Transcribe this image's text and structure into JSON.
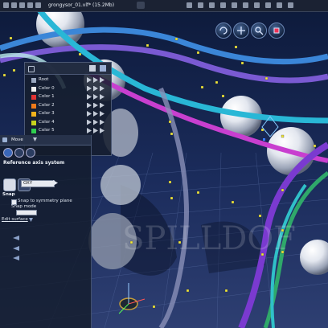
{
  "topbar": {
    "file_title": "grongysor_01.vlf* (15.2Mb)",
    "icons": [
      "file-icon",
      "open-icon",
      "save-icon",
      "undo-icon",
      "redo-icon",
      "render-icon",
      "camera-icon",
      "light-icon",
      "material-icon",
      "layer-icon",
      "settings-icon",
      "help-icon",
      "view-icon",
      "grid-icon",
      "magnet-icon",
      "lock-icon"
    ]
  },
  "tools": {
    "icons": [
      "rotate-view-icon",
      "pan-view-icon",
      "zoom-view-icon",
      "focus-view-icon"
    ]
  },
  "scene": {
    "items": [
      {
        "label": "Root",
        "color": "#9aa8c0"
      },
      {
        "label": "Color 0",
        "color": "#f0f0f0"
      },
      {
        "label": "Color 1",
        "color": "#e23333"
      },
      {
        "label": "Color 2",
        "color": "#f07a1a"
      },
      {
        "label": "Color 3",
        "color": "#f2b21c"
      },
      {
        "label": "Color 4",
        "color": "#c8d41e"
      },
      {
        "label": "Color 5",
        "color": "#2fcf4f"
      }
    ]
  },
  "props": {
    "tool": "Move",
    "ref_axis_title": "Reference axis system",
    "axis_value": "OXY",
    "snap_label": "Snap",
    "snap_sym": "Snap to symmetry plane",
    "snap_mode": "Snap mode",
    "edit_surface": "Edit surface"
  },
  "watermark": "SPILLDOF"
}
